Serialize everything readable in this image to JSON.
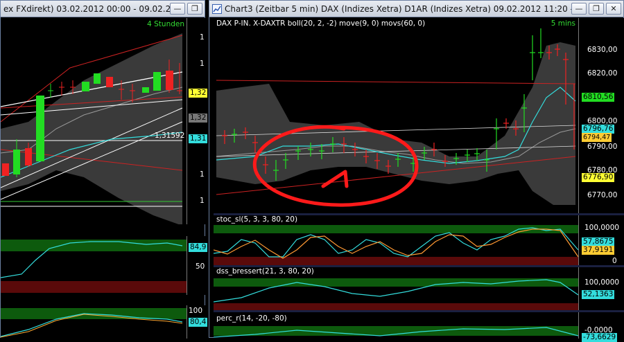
{
  "left_window": {
    "title": "ex FXdirekt) 03.02.2012 00:00 - 09.02.2012 1...",
    "interval": "4 Stunden",
    "axis_labels": [
      "1",
      "1",
      "1",
      "1"
    ],
    "price_tag_yellow": "1,32",
    "price_tag_gray": "1,32",
    "price_tag_cyan": "1,31",
    "level_label": "1,31592",
    "osc1": {
      "tag": "84,9",
      "tick": "50"
    },
    "osc2": {
      "tag1": "100",
      "tag2": "80,4"
    }
  },
  "right_window": {
    "title": "Chart3 (Zeitbar 5 min)  DAX (Indizes Xetra) D1AR (Indizes Xetra) 09.02.2012 11:20 - 09.02...",
    "indicator_header": "DAX P-IN.  X-DAXTR boll(20, 2, -2) move(9, 0) movs(60, 0)",
    "interval": "5 mins",
    "price_axis": [
      "6830,00",
      "6820,00",
      "6810,00",
      "6800,00",
      "6790,00",
      "6780,00",
      "6770,00"
    ],
    "price_tags": {
      "green": "6810,56",
      "cyan": "6796,76",
      "yellow_small": "6794,47",
      "yellow": "6776,90",
      "white_top": "6800,00"
    },
    "stoc": {
      "header": "stoc_sl(5, 3, 3, 80, 20)",
      "axis_top": "100,0000",
      "axis_bottom": "0",
      "tag_cyan": "57,8675",
      "tag_yellow": "37,9191"
    },
    "dss": {
      "header": "dss_bressert(21, 3, 80, 20)",
      "axis_top": "100,0000",
      "tag_cyan": "52,1363"
    },
    "perc": {
      "header": "perc_r(14, -20, -80)",
      "axis_top": "-0,0000",
      "tag_cyan": "-73,6629"
    }
  },
  "window_buttons": {
    "minimize": "—",
    "restore": "❐",
    "close": "✕"
  },
  "colors": {
    "up_candle": "#22dd22",
    "down_candle": "#ee2222",
    "band_fill": "#3a3a3a",
    "ma_cyan": "#33dddd",
    "annotation_red": "#ff1a1a",
    "overbought_green": "#0d5a0d",
    "oversold_red": "#5a0a0a"
  },
  "icons": {
    "chart_icon": "chart-icon"
  }
}
